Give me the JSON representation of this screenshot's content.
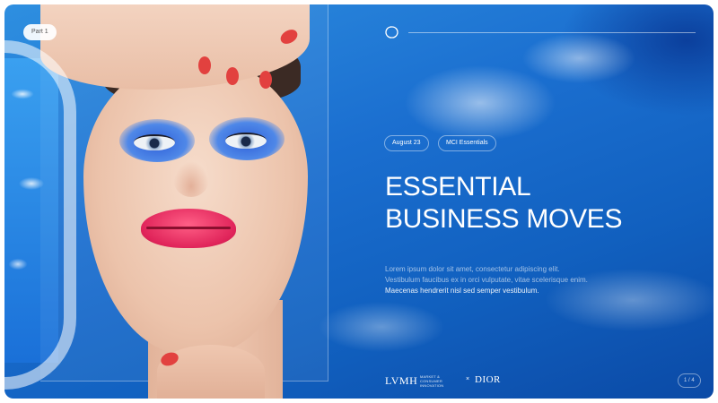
{
  "slide": {
    "part_label": "Part 1",
    "tags": [
      "August 23",
      "MCI Essentials"
    ],
    "title_lines": [
      "ESSENTIAL",
      "BUSINESS MOVES"
    ],
    "body_lines": [
      "Lorem ipsum dolor sit amet, consectetur adipiscing elit.",
      "Vestibulum faucibus ex in orci vulputate, vitae scelerisque enim.",
      "Maecenas hendrerit nisl sed semper vestibulum."
    ],
    "page_indicator": "1 / 4"
  },
  "branding": {
    "top_logo_icon": "cd-monogram-icon",
    "lvmh": "LVMH",
    "lvmh_sub_lines": [
      "MARKET & CONSUMER",
      "INNOVATION"
    ],
    "separator": "×",
    "dior": "DIOR"
  },
  "colors": {
    "water_blue": "#1b6fd0",
    "lipstick": "#e0245a",
    "eyeshadow": "#2e5fd8",
    "text_white": "#ffffff"
  }
}
